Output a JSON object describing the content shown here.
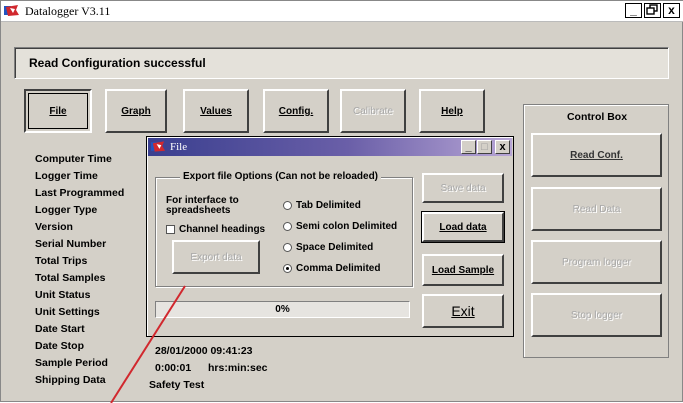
{
  "window": {
    "title": "Datalogger V3.11",
    "buttons": [
      "_",
      "🗗",
      "x"
    ]
  },
  "status": "Read Configuration successful",
  "toolbar": [
    {
      "label": "File",
      "state": "pressed"
    },
    {
      "label": "Graph",
      "state": "normal"
    },
    {
      "label": "Values",
      "state": "normal"
    },
    {
      "label": "Config.",
      "state": "normal"
    },
    {
      "label": "Calibrate",
      "state": "disabled"
    },
    {
      "label": "Help",
      "state": "normal"
    }
  ],
  "info_labels": [
    "Computer Time",
    "Logger Time",
    "Last Programmed",
    "Logger Type",
    "Version",
    "Serial Number",
    "Total Trips",
    "Total Samples",
    "Unit Status",
    "Unit Settings",
    "Date Start",
    "Date Stop",
    "Sample Period",
    "Shipping Data"
  ],
  "info_values": {
    "date_stop": "28/01/2000 09:41:23",
    "sample_period": "0:00:01",
    "sample_period_unit": "hrs:min:sec",
    "shipping_data": "Safety Test"
  },
  "control_box": {
    "title": "Control Box",
    "buttons": [
      {
        "label": "Read Conf.",
        "state": "normal"
      },
      {
        "label": "Read Data",
        "state": "disabled"
      },
      {
        "label": "Program logger",
        "state": "disabled"
      },
      {
        "label": "Stop logger",
        "state": "disabled"
      }
    ]
  },
  "dialog": {
    "title": "File",
    "group_title": "Export file Options (Can not be reloaded)",
    "interface_label_1": "For interface to",
    "interface_label_2": "spreadsheets",
    "channel_headings": "Channel headings",
    "channel_headings_checked": false,
    "radios": [
      {
        "label": "Tab Delimited",
        "selected": false
      },
      {
        "label": "Semi colon Delimited",
        "selected": false
      },
      {
        "label": "Space Delimited",
        "selected": false
      },
      {
        "label": "Comma Delimited",
        "selected": true
      }
    ],
    "export_button": "Export data",
    "save_button": "Save data",
    "load_button": "Load data",
    "load_sample_button": "Load Sample",
    "exit_button": "Exit",
    "progress_percent": 0,
    "progress_text": "0%"
  },
  "colors": {
    "accent": "#d1282e",
    "dialog_title_start": "#3a3f8f",
    "progress": "#1c3f9e"
  }
}
